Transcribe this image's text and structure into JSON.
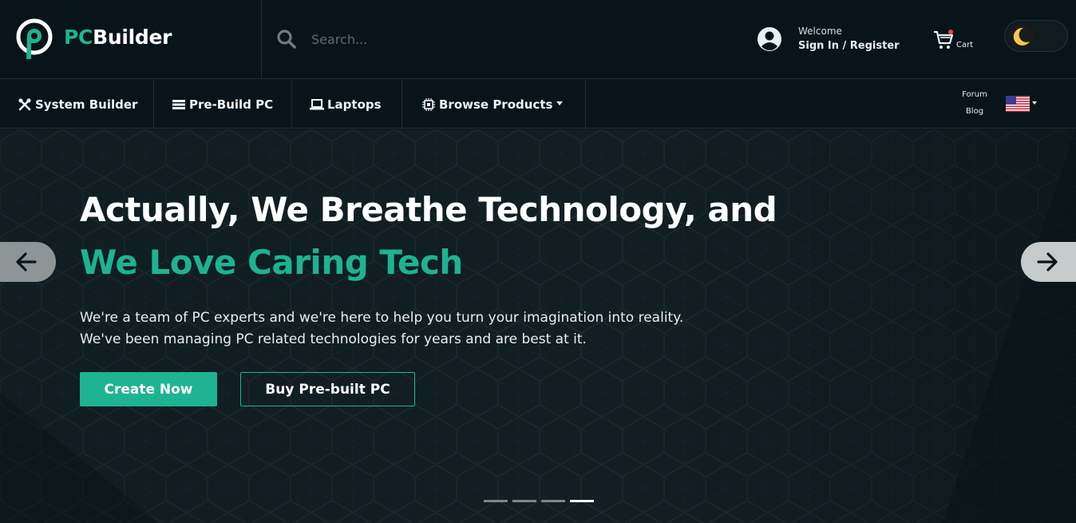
{
  "brand": {
    "prefix": "PC",
    "suffix": "Builder"
  },
  "search": {
    "placeholder": "Search..."
  },
  "account": {
    "welcome": "Welcome",
    "signin": "Sign In / Register"
  },
  "cart": {
    "label": "Cart"
  },
  "nav": {
    "items": [
      {
        "label": "System Builder",
        "icon": "tools-icon"
      },
      {
        "label": "Pre-Build PC",
        "icon": "server-icon"
      },
      {
        "label": "Laptops",
        "icon": "laptop-icon"
      },
      {
        "label": "Browse Products",
        "icon": "chip-icon"
      }
    ],
    "forum": "Forum",
    "blog": "Blog"
  },
  "hero": {
    "title_line1": "Actually, We Breathe Technology, and",
    "title_line2": "We Love Caring Tech",
    "desc_line1": "We're a team of PC experts and we're here to help you turn your imagination into reality.",
    "desc_line2": "We've been managing PC related technologies for years and are best at it.",
    "primary_button": "Create Now",
    "secondary_button": "Buy Pre-built PC",
    "slides_total": 4,
    "active_slide": 4
  },
  "colors": {
    "accent": "#1eb391",
    "background": "#08141a",
    "hero_bg": "#0f1c20"
  }
}
